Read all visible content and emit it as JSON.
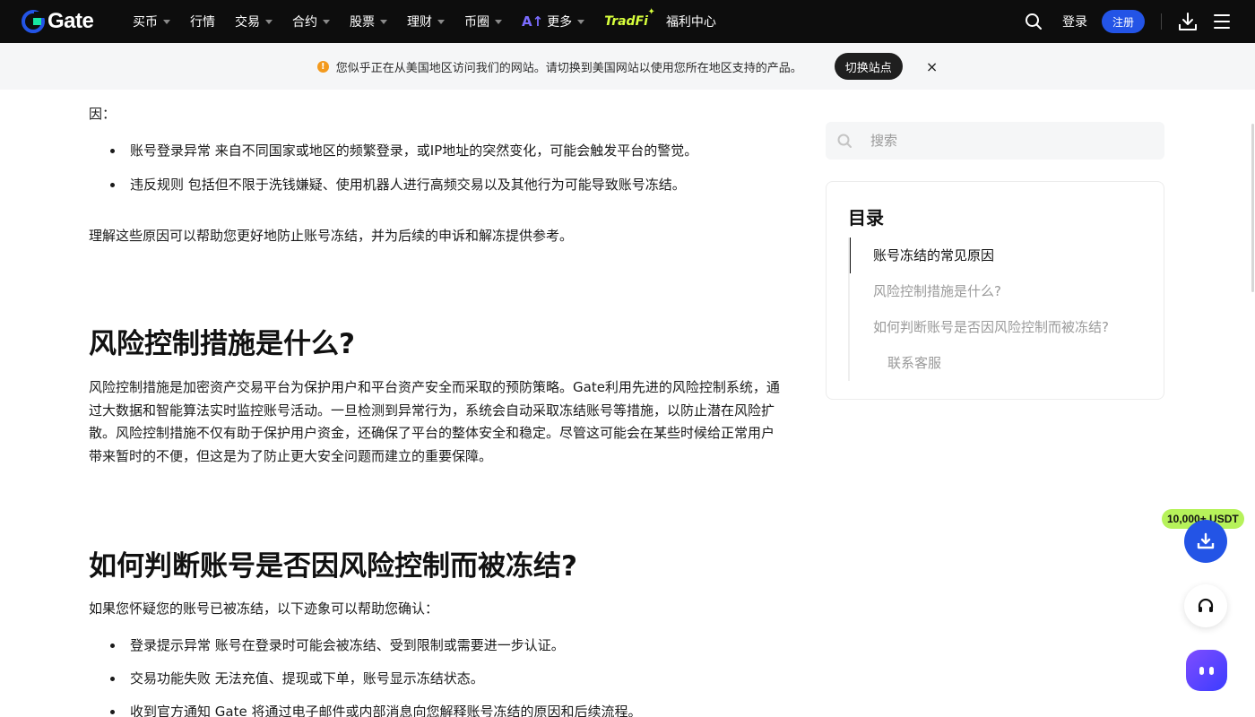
{
  "header": {
    "logo_text": "Gate",
    "nav": [
      {
        "label": "买币",
        "caret": true
      },
      {
        "label": "行情",
        "caret": false
      },
      {
        "label": "交易",
        "caret": true
      },
      {
        "label": "合约",
        "caret": true
      },
      {
        "label": "股票",
        "caret": true
      },
      {
        "label": "理财",
        "caret": true
      },
      {
        "label": "币圈",
        "caret": true
      }
    ],
    "more_label": "更多",
    "tradfi_label": "TradFi",
    "welfare_label": "福利中心",
    "login_label": "登录",
    "register_label": "注册",
    "colors": {
      "bg": "#0d0d0d",
      "accent": "#2354e6",
      "tradfi": "#d8ff3c"
    }
  },
  "banner": {
    "text": "您似乎正在从美国地区访问我们的网站。请切换到美国网站以使用您所在地区支持的产品。",
    "switch_label": "切换站点",
    "close_label": "×"
  },
  "article": {
    "cut_text": "因：",
    "list1": [
      "账号登录异常 来自不同国家或地区的频繁登录，或IP地址的突然变化，可能会触发平台的警觉。",
      "违反规则 包括但不限于洗钱嫌疑、使用机器人进行高频交易以及其他行为可能导致账号冻结。"
    ],
    "para1": "理解这些原因可以帮助您更好地防止账号冻结，并为后续的申诉和解冻提供参考。",
    "h2_risk": "风险控制措施是什么?",
    "para_risk": "风险控制措施是加密资产交易平台为保护用户和平台资产安全而采取的预防策略。Gate利用先进的风险控制系统，通过大数据和智能算法实时监控账号活动。一旦检测到异常行为，系统会自动采取冻结账号等措施，以防止潜在风险扩散。风险控制措施不仅有助于保护用户资金，还确保了平台的整体安全和稳定。尽管这可能会在某些时候给正常用户带来暂时的不便，但这是为了防止更大安全问题而建立的重要保障。",
    "h2_judge": "如何判断账号是否因风险控制而被冻结?",
    "para_judge": "如果您怀疑您的账号已被冻结，以下迹象可以帮助您确认：",
    "list2": [
      "登录提示异常 账号在登录时可能会被冻结、受到限制或需要进一步认证。",
      "交易功能失败 无法充值、提现或下单，账号显示冻结状态。",
      "收到官方通知 Gate 将通过电子邮件或内部消息向您解释账号冻结的原因和后续流程。"
    ]
  },
  "sidebar": {
    "search_placeholder": "搜索",
    "toc_title": "目录",
    "toc": [
      {
        "label": "账号冻结的常见原因",
        "active": true,
        "sub": false
      },
      {
        "label": "风险控制措施是什么?",
        "active": false,
        "sub": false
      },
      {
        "label": "如何判断账号是否因风险控制而被冻结?",
        "active": false,
        "sub": false
      },
      {
        "label": "联系客服",
        "active": false,
        "sub": true
      }
    ]
  },
  "floating": {
    "promo_text": "10,000+ USDT"
  }
}
